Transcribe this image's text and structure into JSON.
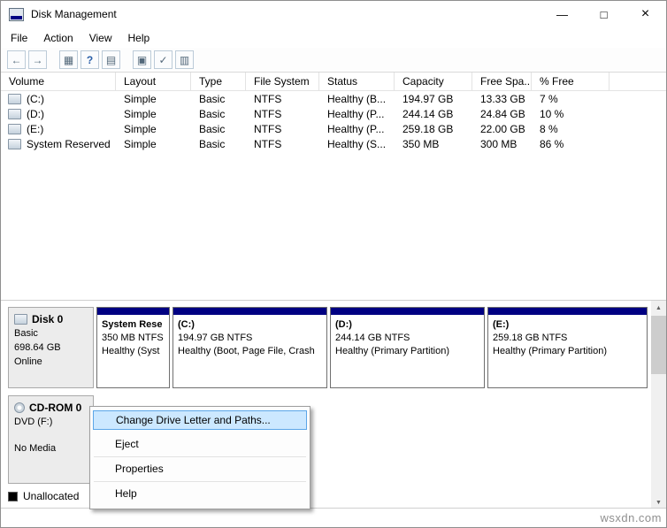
{
  "window": {
    "title": "Disk Management",
    "controls": {
      "minimize": "—",
      "maximize": "□",
      "close": "×"
    }
  },
  "menu": {
    "items": [
      "File",
      "Action",
      "View",
      "Help"
    ]
  },
  "toolbar": {
    "icons": [
      {
        "name": "back-icon",
        "glyph": "←"
      },
      {
        "name": "forward-icon",
        "glyph": "→"
      },
      {
        "name": "console-tree-icon",
        "glyph": "▦"
      },
      {
        "name": "help-icon",
        "glyph": "?"
      },
      {
        "name": "export-list-icon",
        "glyph": "▤"
      },
      {
        "name": "action-pane-icon",
        "glyph": "▣"
      },
      {
        "name": "check-disk-icon",
        "glyph": "✓"
      },
      {
        "name": "properties-icon",
        "glyph": "▥"
      }
    ]
  },
  "volume_table": {
    "columns": [
      "Volume",
      "Layout",
      "Type",
      "File System",
      "Status",
      "Capacity",
      "Free Spa...",
      "% Free"
    ],
    "rows": [
      [
        "(C:)",
        "Simple",
        "Basic",
        "NTFS",
        "Healthy (B...",
        "194.97 GB",
        "13.33 GB",
        "7 %"
      ],
      [
        "(D:)",
        "Simple",
        "Basic",
        "NTFS",
        "Healthy (P...",
        "244.14 GB",
        "24.84 GB",
        "10 %"
      ],
      [
        "(E:)",
        "Simple",
        "Basic",
        "NTFS",
        "Healthy (P...",
        "259.18 GB",
        "22.00 GB",
        "8 %"
      ],
      [
        "System Reserved",
        "Simple",
        "Basic",
        "NTFS",
        "Healthy (S...",
        "350 MB",
        "300 MB",
        "86 %"
      ]
    ]
  },
  "graph": {
    "disk0": {
      "name": "Disk 0",
      "type": "Basic",
      "size": "698.64 GB",
      "status": "Online",
      "partitions": [
        {
          "title": "System Rese",
          "size_line": "350 MB NTFS",
          "status_line": "Healthy (Syst"
        },
        {
          "title": "(C:)",
          "size_line": "194.97 GB NTFS",
          "status_line": "Healthy (Boot, Page File, Crash"
        },
        {
          "title": "(D:)",
          "size_line": "244.14 GB NTFS",
          "status_line": "Healthy (Primary Partition)"
        },
        {
          "title": "(E:)",
          "size_line": "259.18 GB NTFS",
          "status_line": "Healthy (Primary Partition)"
        }
      ]
    },
    "cdrom": {
      "name": "CD-ROM 0",
      "drive": "DVD (F:)",
      "status": "No Media"
    },
    "legend": {
      "unallocated_label": "Unallocated"
    }
  },
  "context_menu": {
    "highlighted_index": 0,
    "items": [
      "Change Drive Letter and Paths...",
      "Eject",
      "Properties",
      "Help"
    ]
  },
  "icons": {
    "app": "disk-management-icon",
    "volume_row": "drive-icon",
    "disk": "drive-icon",
    "cdrom": "disc-icon",
    "scroll_up": "▲",
    "scroll_down": "▼"
  },
  "colors": {
    "primary_partition_bar": "#000082",
    "menu_highlight_fill": "#cce8ff",
    "menu_highlight_border": "#5ba6e8",
    "unallocated_swatch": "#000000"
  },
  "watermark": "wsxdn.com"
}
